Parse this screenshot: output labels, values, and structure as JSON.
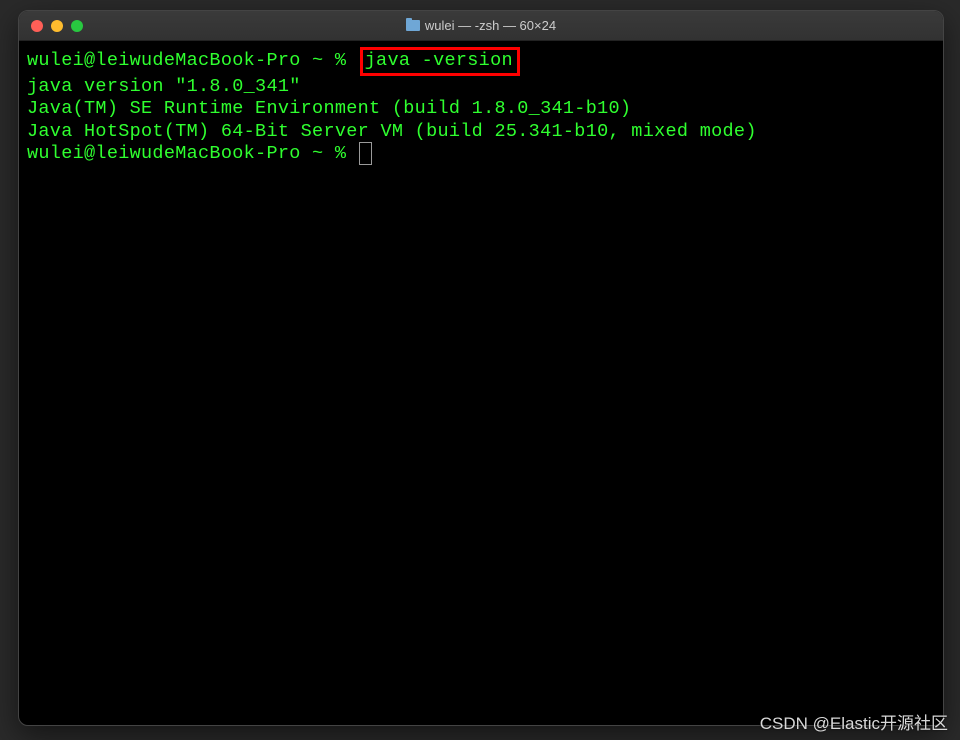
{
  "window": {
    "title": "wulei — -zsh — 60×24"
  },
  "terminal": {
    "prompt1_user": "wulei@leiwudeMacBook-Pro ~ % ",
    "command1": "java -version",
    "output_line1": "java version \"1.8.0_341\"",
    "output_line2": "Java(TM) SE Runtime Environment (build 1.8.0_341-b10)",
    "output_line3": "Java HotSpot(TM) 64-Bit Server VM (build 25.341-b10, mixed mode)",
    "prompt2_user": "wulei@leiwudeMacBook-Pro ~ % "
  },
  "watermark": "CSDN @Elastic开源社区"
}
